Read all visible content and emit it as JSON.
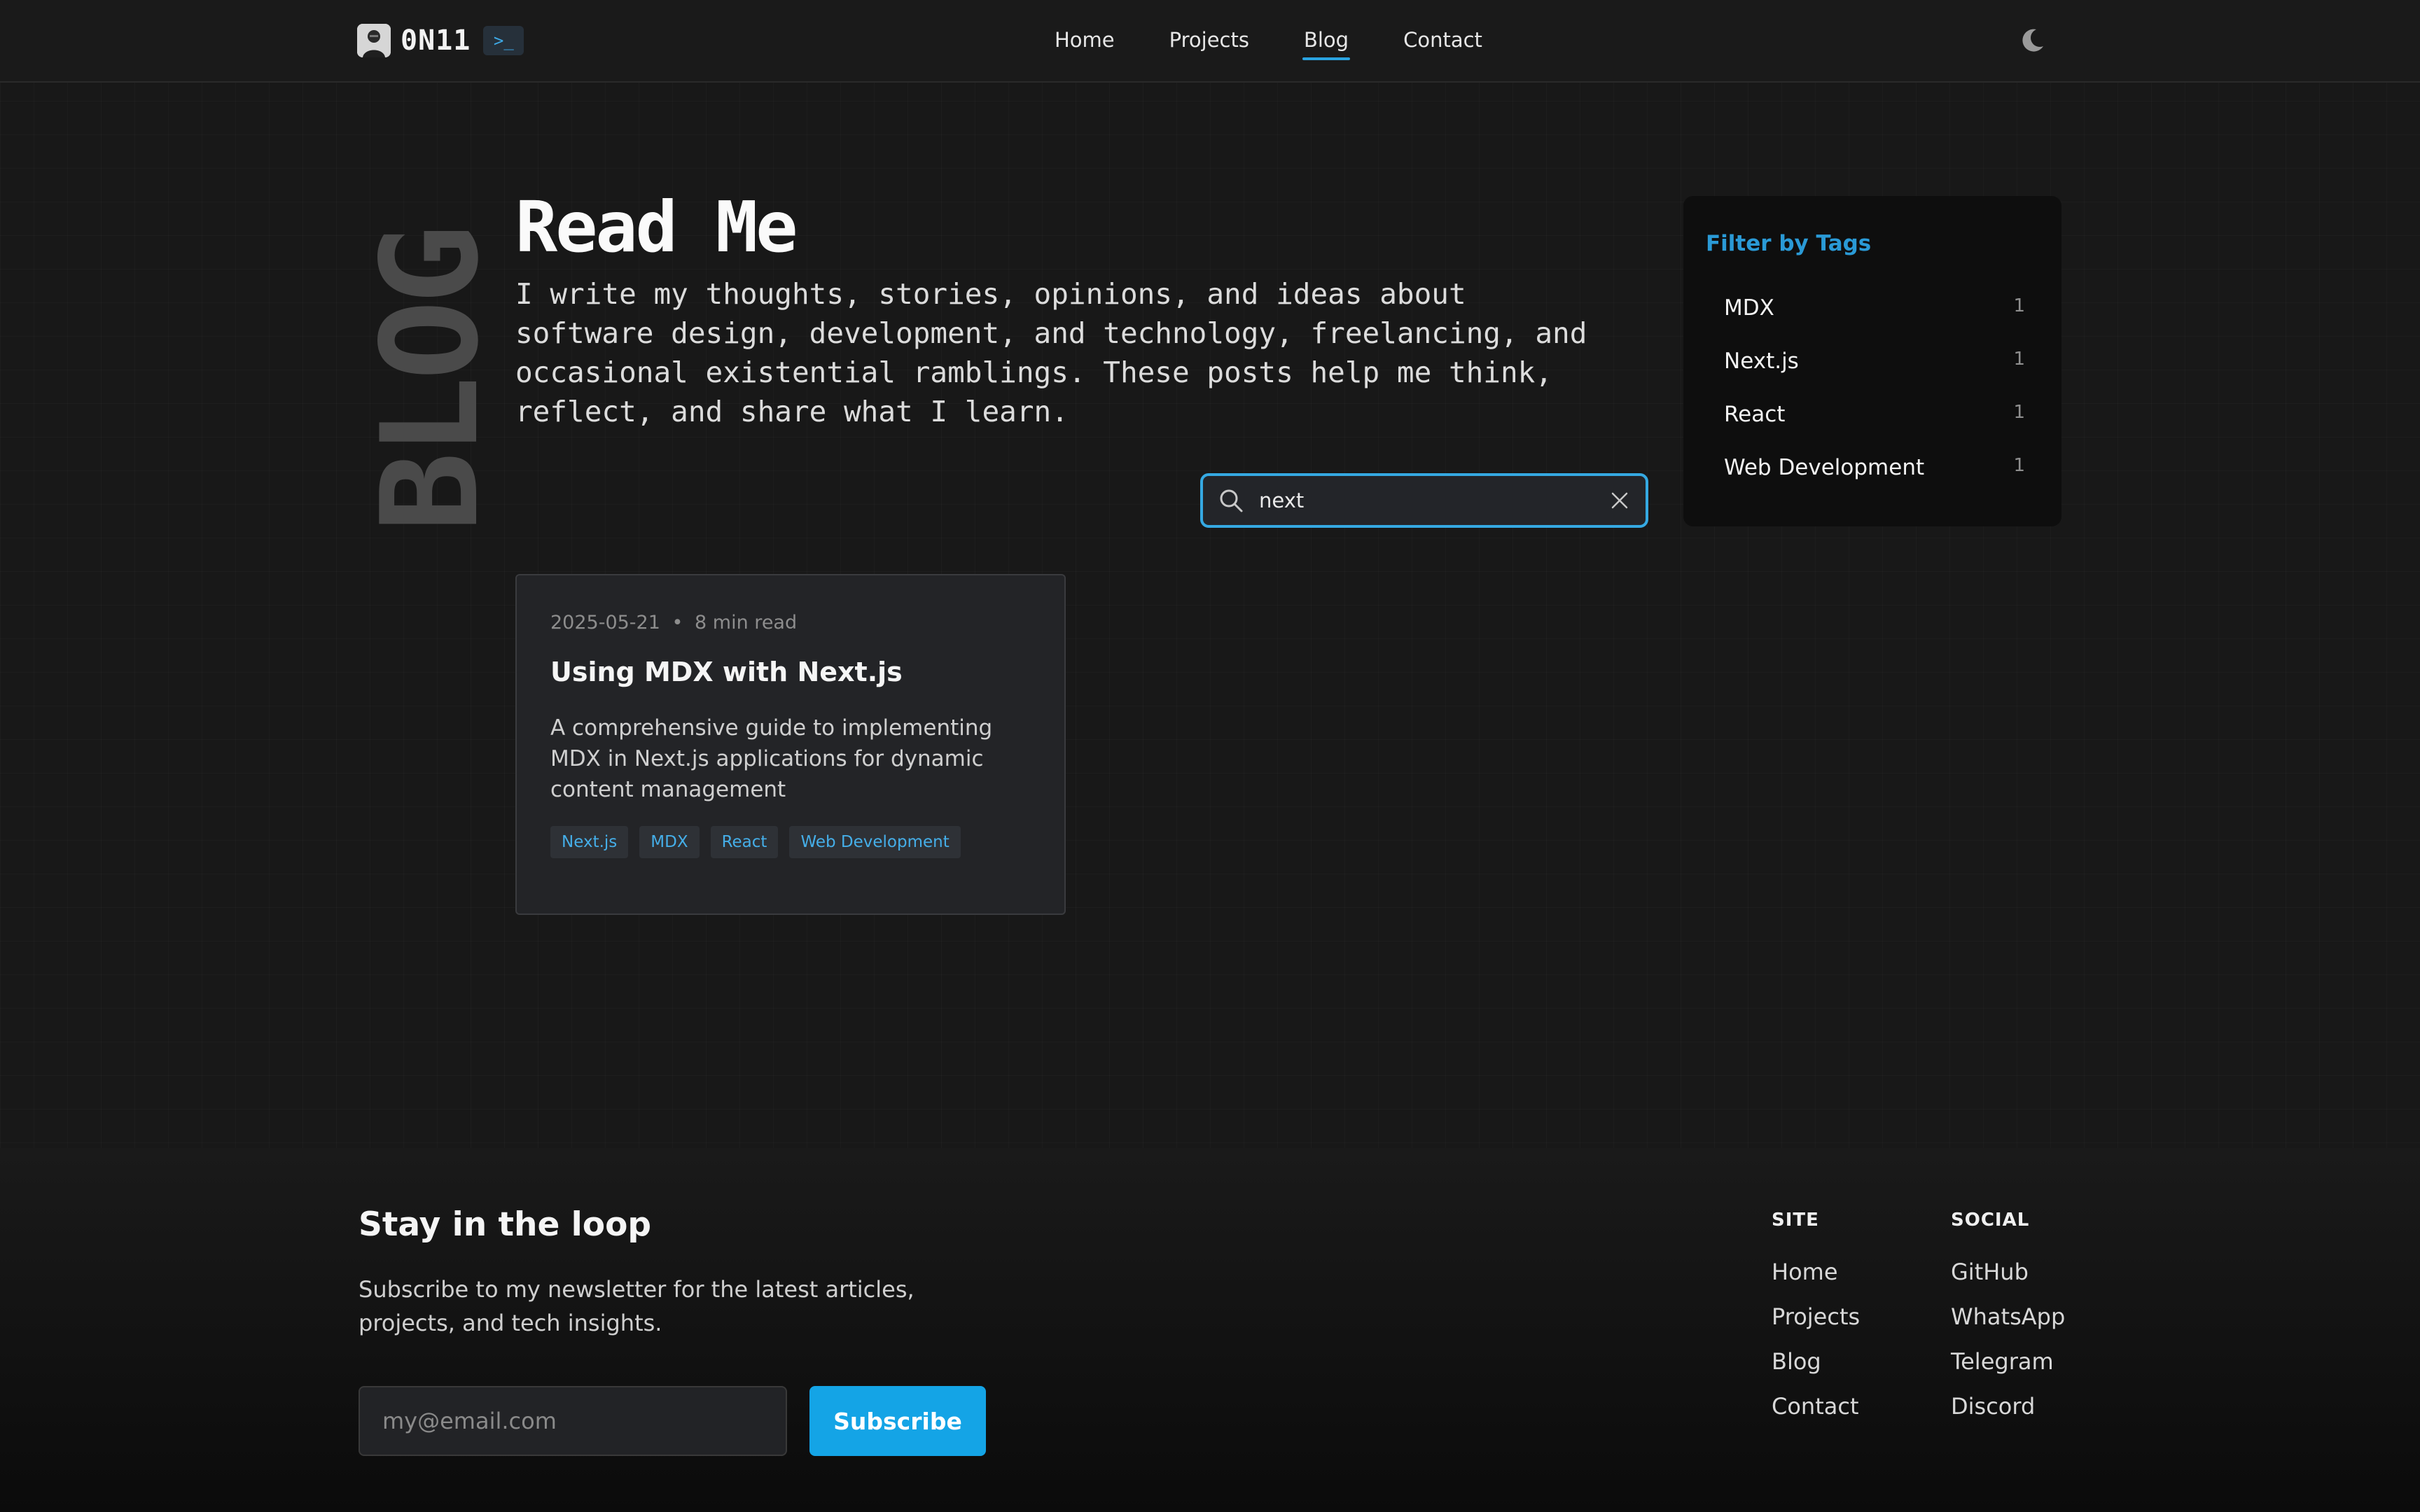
{
  "header": {
    "brand": "0N11",
    "terminal_badge": ">_",
    "nav": [
      {
        "label": "Home",
        "active": false
      },
      {
        "label": "Projects",
        "active": false
      },
      {
        "label": "Blog",
        "active": true
      },
      {
        "label": "Contact",
        "active": false
      }
    ],
    "theme_icon": "moon-icon"
  },
  "hero": {
    "vertical_label": "BLOG",
    "title": "Read Me",
    "intro": "I write my thoughts, stories, opinions, and ideas about software design, development, and technology, freelancing, and occasional existential ramblings. These posts help me think, reflect, and share what I learn.",
    "search": {
      "value": "next",
      "icon": "search-icon",
      "clear_icon": "close-icon"
    }
  },
  "filter": {
    "title": "Filter by Tags",
    "tags": [
      {
        "name": "MDX",
        "count": "1"
      },
      {
        "name": "Next.js",
        "count": "1"
      },
      {
        "name": "React",
        "count": "1"
      },
      {
        "name": "Web Development",
        "count": "1"
      }
    ]
  },
  "posts": [
    {
      "date": "2025-05-21",
      "separator": "•",
      "read_time": "8 min read",
      "title": "Using MDX with Next.js",
      "excerpt": "A comprehensive guide to implementing MDX in Next.js applications for dynamic content management",
      "tags": [
        "Next.js",
        "MDX",
        "React",
        "Web Development"
      ]
    }
  ],
  "footer": {
    "heading": "Stay in the loop",
    "text": "Subscribe to my newsletter for the latest articles, projects, and tech insights.",
    "email_placeholder": "my@email.com",
    "subscribe_label": "Subscribe",
    "site": {
      "title": "SITE",
      "links": [
        "Home",
        "Projects",
        "Blog",
        "Contact"
      ]
    },
    "social": {
      "title": "SOCIAL",
      "links": [
        "GitHub",
        "WhatsApp",
        "Telegram",
        "Discord"
      ]
    }
  },
  "colors": {
    "accent": "#14a4e6",
    "background": "#181818"
  }
}
